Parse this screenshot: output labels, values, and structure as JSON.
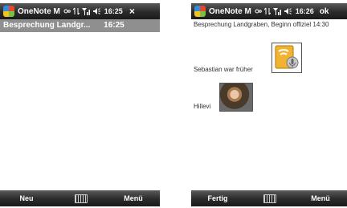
{
  "left": {
    "titlebar": {
      "app_name": "OneNote M",
      "time": "16:25",
      "close_label": "×"
    },
    "note_header": {
      "title": "Besprechung Landgr...",
      "time": "16:25"
    },
    "softkeys": {
      "left": "Neu",
      "right": "Menü"
    }
  },
  "right": {
    "titlebar": {
      "app_name": "OneNote M",
      "time": "16:26",
      "ok_label": "ok"
    },
    "note": {
      "title_line": "Besprechung Landgraben, Beginn offiziel 14:30",
      "line1": "Sebastian war früher",
      "line2": "Hillevi"
    },
    "softkeys": {
      "left": "Fertig",
      "right": "Menü"
    }
  },
  "icons": {
    "start": "windows-start-icon",
    "bluetooth": "bluetooth-icon",
    "connectivity": "data-connection-icon",
    "signal": "signal-icon",
    "volume": "speaker-icon",
    "keyboard": "keyboard-icon",
    "audio": "audio-recording-icon"
  }
}
